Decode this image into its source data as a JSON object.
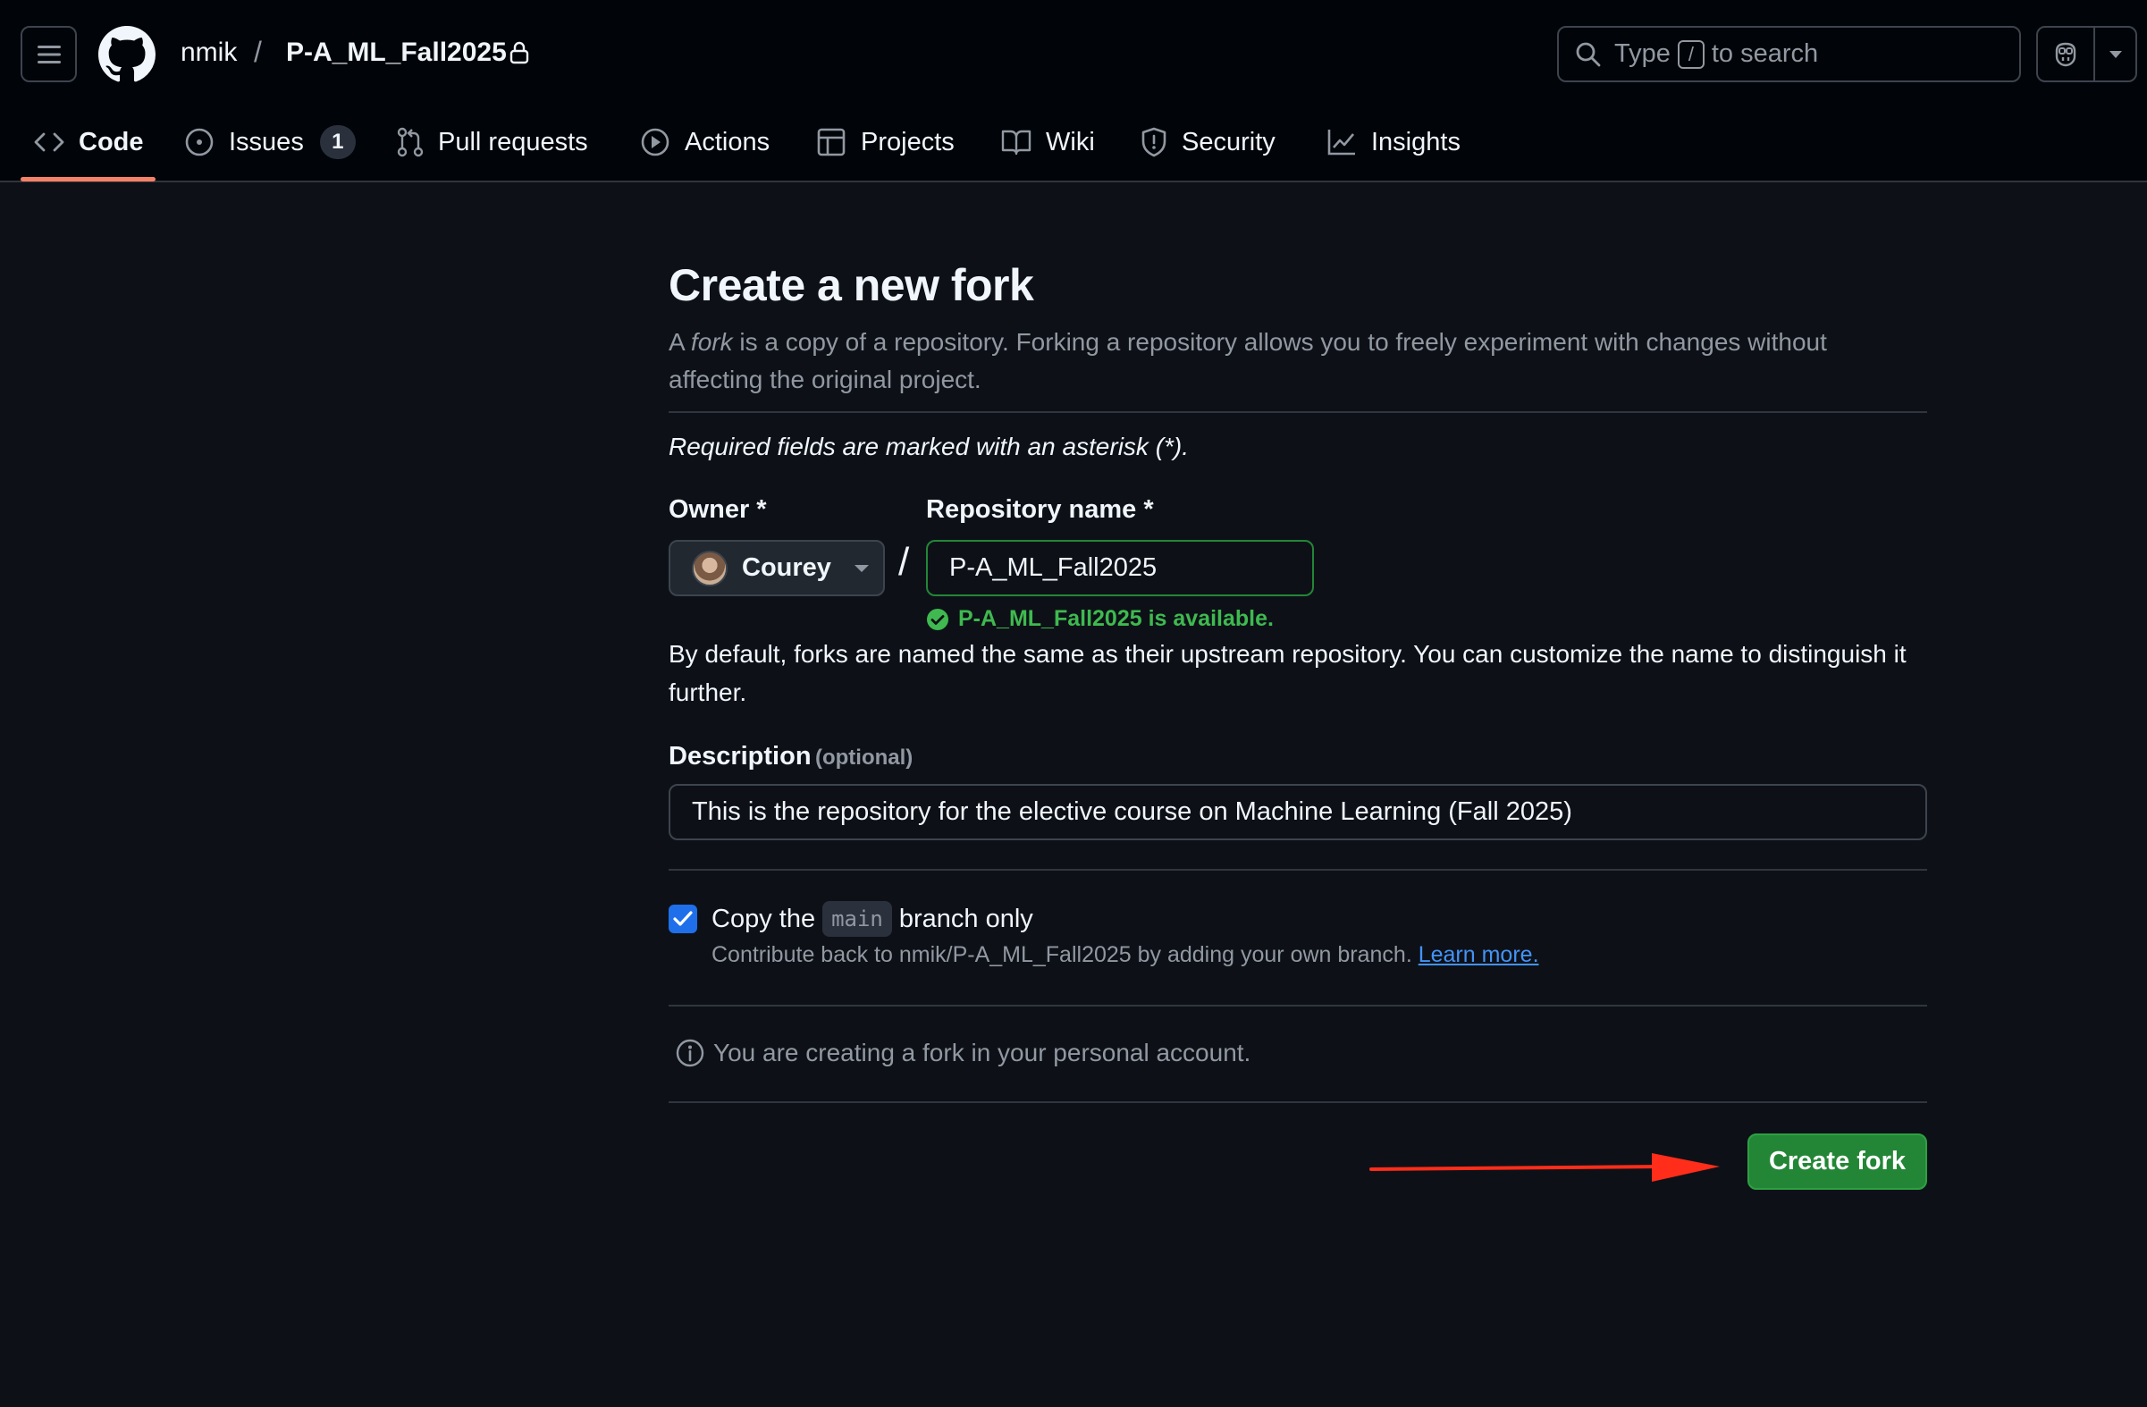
{
  "header": {
    "owner": "nmik",
    "separator": "/",
    "repo": "P-A_ML_Fall2025",
    "search": {
      "prefix": "Type",
      "key": "/",
      "suffix": "to search"
    }
  },
  "nav": {
    "tabs": [
      {
        "label": "Code",
        "icon": "code-icon",
        "active": true
      },
      {
        "label": "Issues",
        "icon": "issue-icon",
        "count": "1"
      },
      {
        "label": "Pull requests",
        "icon": "pull-request-icon"
      },
      {
        "label": "Actions",
        "icon": "play-icon"
      },
      {
        "label": "Projects",
        "icon": "table-icon"
      },
      {
        "label": "Wiki",
        "icon": "book-icon"
      },
      {
        "label": "Security",
        "icon": "shield-icon"
      },
      {
        "label": "Insights",
        "icon": "graph-icon"
      }
    ]
  },
  "form": {
    "title": "Create a new fork",
    "subtitle_pre": "A ",
    "subtitle_em": "fork",
    "subtitle_post": " is a copy of a repository. Forking a repository allows you to freely experiment with changes without affecting the original project.",
    "required_note": "Required fields are marked with an asterisk (*).",
    "owner_label": "Owner *",
    "owner_value": "Courey",
    "repo_label": "Repository name *",
    "repo_value": "P-A_ML_Fall2025",
    "slash": "/",
    "availability": "P-A_ML_Fall2025 is available.",
    "naming_note": "By default, forks are named the same as their upstream repository. You can customize the name to distinguish it further.",
    "description_label": "Description",
    "description_optional": "(optional)",
    "description_value": "This is the repository for the elective course on Machine Learning (Fall 2025)",
    "copy_branch": {
      "checked": true,
      "pre": "Copy the",
      "branch": "main",
      "post": "branch only",
      "hint": "Contribute back to nmik/P-A_ML_Fall2025 by adding your own branch.",
      "learn_more": "Learn more."
    },
    "info": "You are creating a fork in your personal account.",
    "submit": "Create fork"
  },
  "colors": {
    "background": "#0d1117",
    "primary_button": "#238636",
    "success": "#3fb950",
    "accent_underline": "#f78166",
    "link": "#4493f8",
    "annotation_arrow": "#ff2d1a"
  }
}
